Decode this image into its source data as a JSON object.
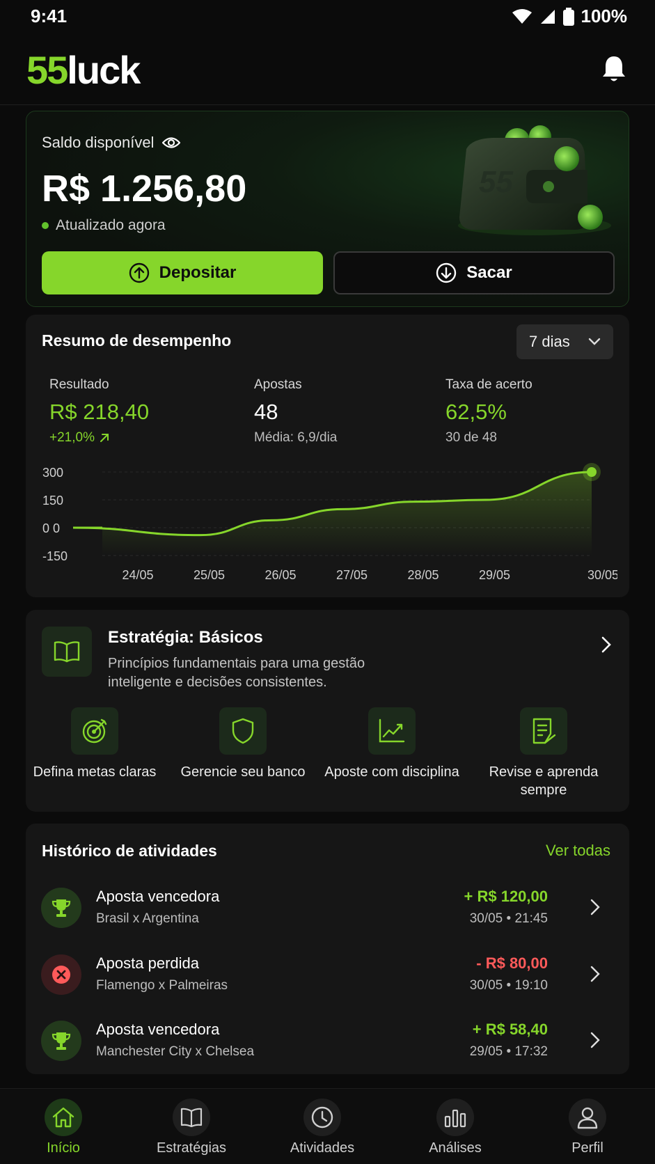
{
  "status_bar": {
    "time": "9:41",
    "battery": "100%"
  },
  "header": {
    "logo_num": "55",
    "logo_word": "luck"
  },
  "balance": {
    "label": "Saldo disponível",
    "value": "R$ 1.256,80",
    "updated": "Atualizado agora",
    "deposit_label": "Depositar",
    "withdraw_label": "Sacar",
    "wallet_mark": "55"
  },
  "performance": {
    "title": "Resumo de desempenho",
    "period": "7 dias",
    "stats": [
      {
        "label": "Resultado",
        "value": "R$ 218,40",
        "sub": "+21,0%"
      },
      {
        "label": "Apostas",
        "value": "48",
        "sub": "Média: 6,9/dia"
      },
      {
        "label": "Taxa de acerto",
        "value": "62,5%",
        "sub": "30 de 48"
      }
    ]
  },
  "chart_data": {
    "type": "area",
    "x": [
      "24/05",
      "25/05",
      "26/05",
      "27/05",
      "28/05",
      "29/05",
      "30/05"
    ],
    "series": [
      {
        "values": [
          0,
          -40,
          40,
          100,
          140,
          150,
          300
        ]
      }
    ],
    "y_ticks": [
      "300",
      "150",
      "0 0",
      "-150"
    ],
    "ylim": [
      -150,
      300
    ],
    "grid": true,
    "colors": {
      "line": "#86d62b"
    }
  },
  "strategy": {
    "title": "Estratégia: Básicos",
    "description": "Princípios fundamentais para uma gestão inteligente e decisões consistentes.",
    "tips": [
      {
        "label": "Defina metas claras",
        "icon": "target-icon"
      },
      {
        "label": "Gerencie seu banco",
        "icon": "shield-icon"
      },
      {
        "label": "Aposte com disciplina",
        "icon": "trend-chart-icon"
      },
      {
        "label": "Revise e aprenda sempre",
        "icon": "notes-icon"
      }
    ]
  },
  "history": {
    "title": "Histórico de atividades",
    "see_all": "Ver todas",
    "items": [
      {
        "title": "Aposta vencedora",
        "match": "Brasil x Argentina",
        "amount": "+ R$ 120,00",
        "date": "30/05 • 21:45",
        "status": "win"
      },
      {
        "title": "Aposta perdida",
        "match": "Flamengo x Palmeiras",
        "amount": "- R$ 80,00",
        "date": "30/05 • 19:10",
        "status": "loss"
      },
      {
        "title": "Aposta vencedora",
        "match": "Manchester City x Chelsea",
        "amount": "+ R$ 58,40",
        "date": "29/05 • 17:32",
        "status": "win"
      }
    ]
  },
  "nav": {
    "items": [
      {
        "label": "Início",
        "icon": "home-icon",
        "active": true
      },
      {
        "label": "Estratégias",
        "icon": "book-icon",
        "active": false
      },
      {
        "label": "Atividades",
        "icon": "clock-icon",
        "active": false
      },
      {
        "label": "Análises",
        "icon": "bar-chart-icon",
        "active": false
      },
      {
        "label": "Perfil",
        "icon": "user-icon",
        "active": false
      }
    ]
  },
  "colors": {
    "accent": "#86d62b",
    "negative": "#ff5a5a",
    "background": "#0b0b0b",
    "card": "#161616"
  }
}
